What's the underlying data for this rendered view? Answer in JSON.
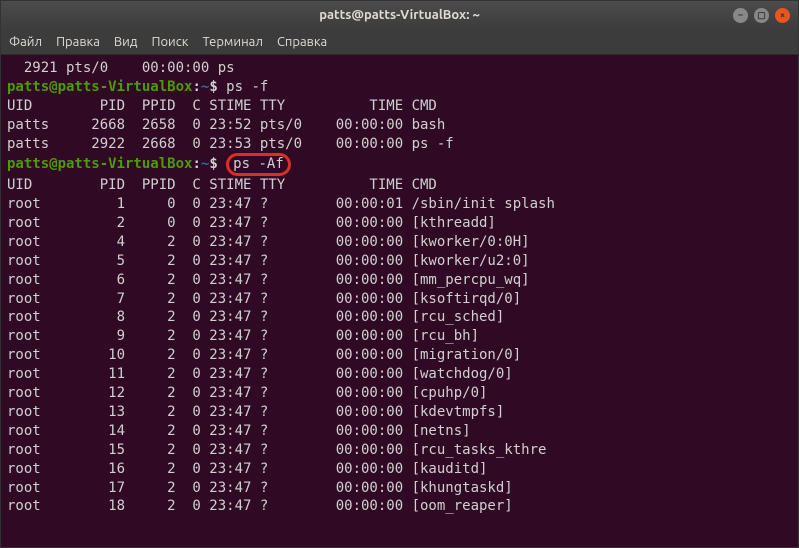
{
  "titlebar": {
    "title": "patts@patts-VirtualBox: ~"
  },
  "menubar": {
    "items": [
      "Файл",
      "Правка",
      "Вид",
      "Поиск",
      "Терминал",
      "Справка"
    ]
  },
  "terminal": {
    "line_top": "  2921 pts/0    00:00:00 ps",
    "prompt": {
      "user": "patts@patts-VirtualBox",
      "sep": ":",
      "path": "~",
      "dollar": "$ "
    },
    "cmd1": "ps -f",
    "header1": "UID        PID  PPID  C STIME TTY          TIME CMD",
    "rows1": [
      "patts     2668  2658  0 23:52 pts/0    00:00:00 bash",
      "patts     2922  2668  0 23:53 pts/0    00:00:00 ps -f"
    ],
    "cmd2": "ps -Af",
    "header2": "UID        PID  PPID  C STIME TTY          TIME CMD",
    "rows2": [
      "root         1     0  0 23:47 ?        00:00:01 /sbin/init splash",
      "root         2     0  0 23:47 ?        00:00:00 [kthreadd]",
      "root         4     2  0 23:47 ?        00:00:00 [kworker/0:0H]",
      "root         5     2  0 23:47 ?        00:00:00 [kworker/u2:0]",
      "root         6     2  0 23:47 ?        00:00:00 [mm_percpu_wq]",
      "root         7     2  0 23:47 ?        00:00:00 [ksoftirqd/0]",
      "root         8     2  0 23:47 ?        00:00:00 [rcu_sched]",
      "root         9     2  0 23:47 ?        00:00:00 [rcu_bh]",
      "root        10     2  0 23:47 ?        00:00:00 [migration/0]",
      "root        11     2  0 23:47 ?        00:00:00 [watchdog/0]",
      "root        12     2  0 23:47 ?        00:00:00 [cpuhp/0]",
      "root        13     2  0 23:47 ?        00:00:00 [kdevtmpfs]",
      "root        14     2  0 23:47 ?        00:00:00 [netns]",
      "root        15     2  0 23:47 ?        00:00:00 [rcu_tasks_kthre",
      "root        16     2  0 23:47 ?        00:00:00 [kauditd]",
      "root        17     2  0 23:47 ?        00:00:00 [khungtaskd]",
      "root        18     2  0 23:47 ?        00:00:00 [oom_reaper]"
    ]
  }
}
